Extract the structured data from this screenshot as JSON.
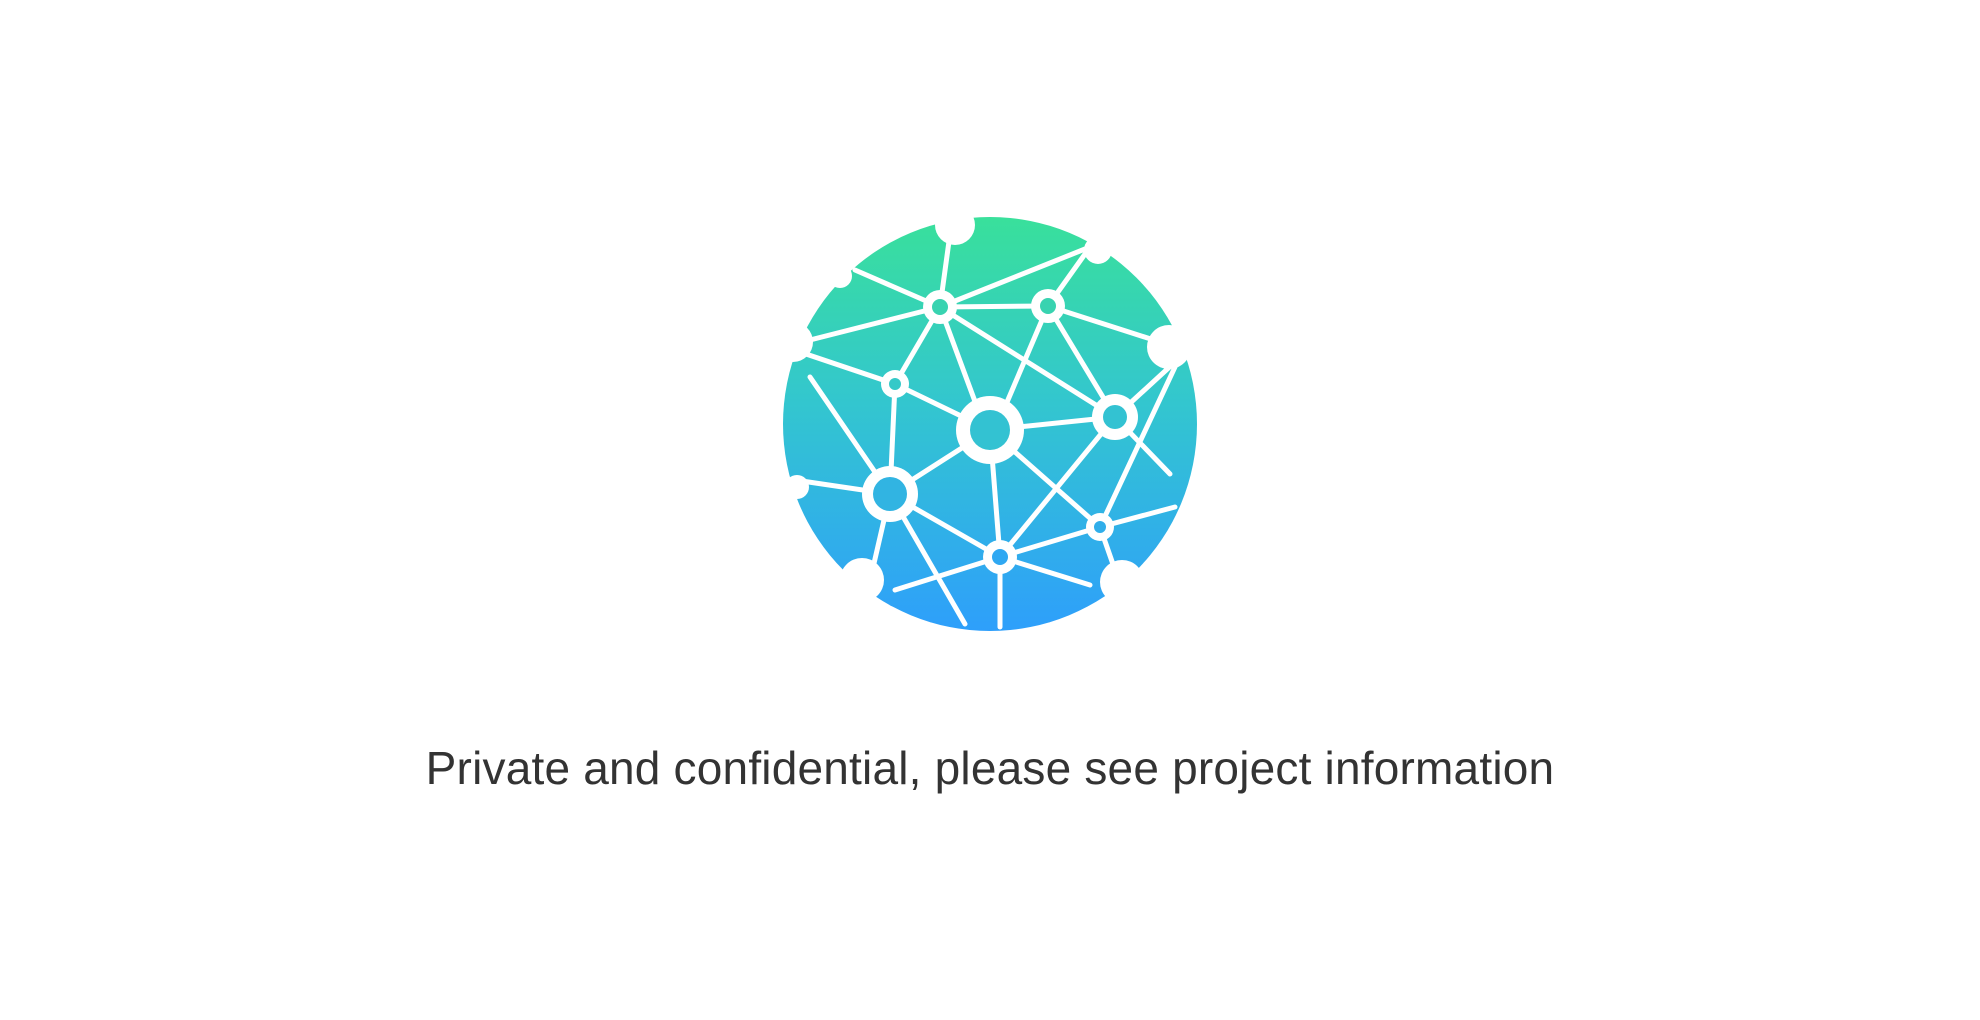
{
  "logo": {
    "icon": "network-globe-icon",
    "gradient_top": "#39e09b",
    "gradient_bottom": "#2e9ffb"
  },
  "message": "Private and confidential, please see project information"
}
